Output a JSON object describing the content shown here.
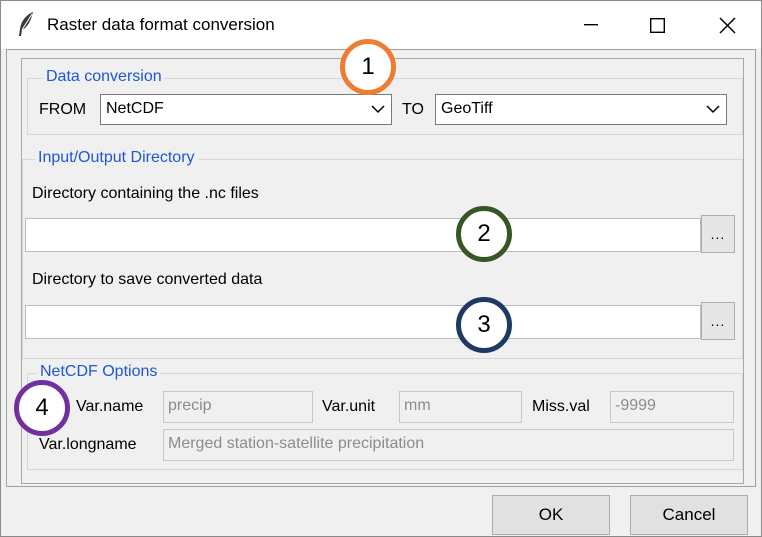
{
  "window": {
    "title": "Raster data format conversion"
  },
  "conversion": {
    "legend": "Data conversion",
    "from_label": "FROM",
    "from_value": "NetCDF",
    "to_label": "TO",
    "to_value": "GeoTiff"
  },
  "io": {
    "legend": "Input/Output Directory",
    "input_label": "Directory containing the .nc files",
    "input_value": "",
    "output_label": "Directory to save converted data",
    "output_value": "",
    "browse_label": "..."
  },
  "netcdf": {
    "legend": "NetCDF Options",
    "varname_label": "Var.name",
    "varname_value": "precip",
    "varunit_label": "Var.unit",
    "varunit_value": "mm",
    "missval_label": "Miss.val",
    "missval_value": "-9999",
    "longname_label": "Var.longname",
    "longname_value": "Merged station-satellite precipitation"
  },
  "callouts": [
    {
      "number": "1",
      "color": "#ee7d31"
    },
    {
      "number": "2",
      "color": "#375623"
    },
    {
      "number": "3",
      "color": "#1f3864"
    },
    {
      "number": "4",
      "color": "#7030a0"
    }
  ],
  "buttons": {
    "ok": "OK",
    "cancel": "Cancel"
  }
}
